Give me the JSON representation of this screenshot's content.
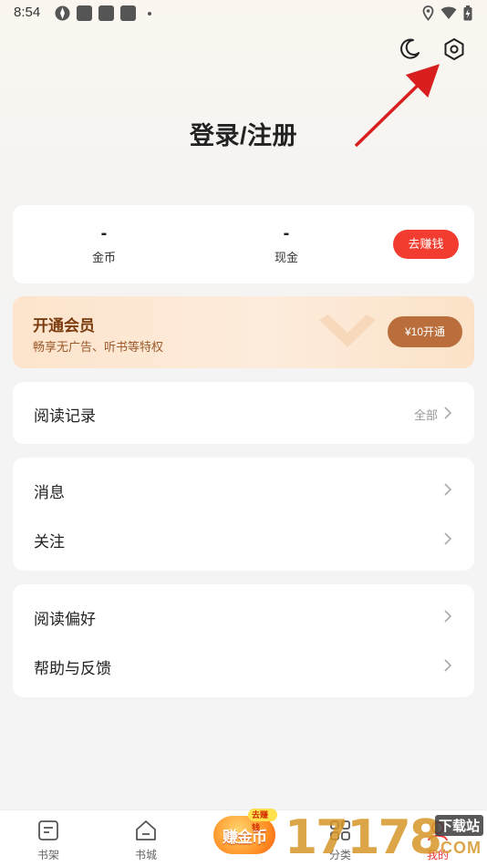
{
  "status_bar": {
    "time": "8:54"
  },
  "header": {
    "title": "登录/注册",
    "icons": [
      "moon-icon",
      "settings-icon"
    ]
  },
  "balance": {
    "coins_value": "-",
    "coins_label": "金币",
    "cash_value": "-",
    "cash_label": "现金",
    "earn_button": "去赚钱"
  },
  "vip": {
    "title": "开通会员",
    "subtitle": "畅享无广告、听书等特权",
    "button": "¥10开通"
  },
  "reading_history": {
    "label": "阅读记录",
    "extra": "全部"
  },
  "menu_group_1": [
    {
      "label": "消息"
    },
    {
      "label": "关注"
    }
  ],
  "menu_group_2": [
    {
      "label": "阅读偏好"
    },
    {
      "label": "帮助与反馈"
    }
  ],
  "bottom_nav": {
    "items": [
      {
        "label": "书架",
        "icon": "bookshelf-icon"
      },
      {
        "label": "书城",
        "icon": "home-icon"
      },
      {
        "label": "分类",
        "icon": "category-icon"
      },
      {
        "label": "我的",
        "icon": "profile-icon"
      }
    ],
    "earn_badge": "赚金币",
    "earn_badge_tag": "去赚钱"
  },
  "watermark": {
    "digits": "17178",
    "tag": "下载站",
    "domain": ".COM"
  },
  "colors": {
    "accent_red": "#f23c2f",
    "vip_brown": "#b96e3c",
    "annotation_arrow": "#d81e1e"
  }
}
